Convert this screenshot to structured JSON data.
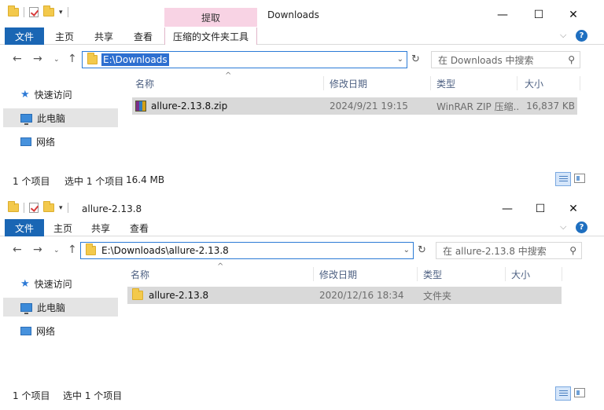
{
  "windows": [
    {
      "title": "Downloads",
      "context_tab": "提取",
      "ribbon_tabs": [
        "文件",
        "主页",
        "共享",
        "查看",
        "压缩的文件夹工具"
      ],
      "address": "E:\\Downloads",
      "search_placeholder": "在 Downloads 中搜索",
      "nav": [
        "快速访问",
        "此电脑",
        "网络"
      ],
      "columns": [
        "名称",
        "修改日期",
        "类型",
        "大小"
      ],
      "rows": [
        {
          "name": "allure-2.13.8.zip",
          "date": "2024/9/21 19:15",
          "type": "WinRAR ZIP 压缩...",
          "size": "16,837 KB",
          "icon": "winrar-icon"
        }
      ],
      "status_count": "1 个项目",
      "status_selected": "选中 1 个项目",
      "status_size": "16.4 MB"
    },
    {
      "title": "allure-2.13.8",
      "ribbon_tabs": [
        "文件",
        "主页",
        "共享",
        "查看"
      ],
      "address": "E:\\Downloads\\allure-2.13.8",
      "search_placeholder": "在 allure-2.13.8 中搜索",
      "nav": [
        "快速访问",
        "此电脑",
        "网络"
      ],
      "columns": [
        "名称",
        "修改日期",
        "类型",
        "大小"
      ],
      "rows": [
        {
          "name": "allure-2.13.8",
          "date": "2020/12/16 18:34",
          "type": "文件夹",
          "size": "",
          "icon": "folder-icon"
        }
      ],
      "status_count": "1 个项目",
      "status_selected": "选中 1 个项目"
    }
  ],
  "controls": {
    "minimize": "—",
    "maximize": "☐",
    "close": "✕",
    "help": "?",
    "chevron": "⌵"
  },
  "glyphs": {
    "back": "←",
    "forward": "→",
    "recent": "⌄",
    "up": "↑",
    "dropdown": "⌄",
    "refresh": "↻",
    "search": "⚲",
    "star": "★",
    "sort": "^"
  }
}
